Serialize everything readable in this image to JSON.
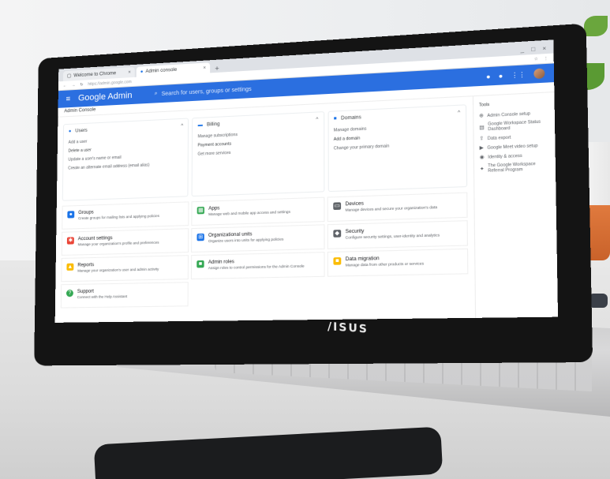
{
  "browser": {
    "tabs": [
      {
        "label": "Welcome to Chrome",
        "active": false
      },
      {
        "label": "Admin console",
        "active": true
      }
    ],
    "new_tab": "+",
    "window_controls": [
      "_",
      "□",
      "×"
    ],
    "url": "https://admin.google.com"
  },
  "app": {
    "title": "Google Admin",
    "search_placeholder": "Search for users, groups or settings",
    "breadcrumb": "Admin Console",
    "accent": "#2b6fe0"
  },
  "cards": [
    {
      "title": "Users",
      "icon": "person-icon",
      "color": "#1a73e8",
      "lines": [
        "Add a user",
        "Delete a user",
        "Update a user's name or email",
        "Create an alternate email address (email alias)"
      ]
    },
    {
      "title": "Billing",
      "icon": "credit-card-icon",
      "color": "#1a73e8",
      "lines": [
        "Manage subscriptions",
        "Payment accounts",
        "Get more services"
      ]
    },
    {
      "title": "Domains",
      "icon": "domains-icon",
      "color": "#1a73e8",
      "lines": [
        "Manage domains",
        "Add a domain",
        "Change your primary domain"
      ]
    }
  ],
  "tiles": [
    {
      "title": "Groups",
      "desc": "Create groups for mailing lists and applying policies",
      "icon": "group-icon",
      "color": "#1a73e8"
    },
    {
      "title": "Apps",
      "desc": "Manage web and mobile app access and settings",
      "icon": "apps-icon",
      "color": "#34a853"
    },
    {
      "title": "Devices",
      "desc": "Manage devices and secure your organization's data",
      "icon": "devices-icon",
      "color": "#5f6368"
    },
    {
      "title": "Account settings",
      "desc": "Manage your organization's profile and preferences",
      "icon": "settings-icon",
      "color": "#ea4335"
    },
    {
      "title": "Organizational units",
      "desc": "Organize users into units for applying policies",
      "icon": "org-units-icon",
      "color": "#1a73e8"
    },
    {
      "title": "Security",
      "desc": "Configure security settings, user-identity and analytics",
      "icon": "shield-icon",
      "color": "#5f6368"
    },
    {
      "title": "Reports",
      "desc": "Manage your organization's user and admin activity",
      "icon": "reports-icon",
      "color": "#fbbc04"
    },
    {
      "title": "Admin roles",
      "desc": "Assign roles to control permissions for the Admin Console",
      "icon": "admin-roles-icon",
      "color": "#34a853"
    },
    {
      "title": "Data migration",
      "desc": "Manage data from other products or services",
      "icon": "migration-icon",
      "color": "#fbbc04"
    },
    {
      "title": "Support",
      "desc": "Connect with the Help Assistant",
      "icon": "support-icon",
      "color": "#34a853"
    }
  ],
  "tools": {
    "heading": "Tools",
    "items": [
      {
        "label": "Admin Console setup",
        "icon": "setup-icon"
      },
      {
        "label": "Google Workspace Status Dashboard",
        "icon": "dashboard-icon"
      },
      {
        "label": "Data export",
        "icon": "export-icon"
      },
      {
        "label": "Google Meet video setup",
        "icon": "video-icon"
      },
      {
        "label": "Identity & access",
        "icon": "identity-icon"
      },
      {
        "label": "The Google Workspace Referral Program",
        "icon": "referral-icon"
      }
    ]
  },
  "device": {
    "brand": "/ISUS"
  }
}
